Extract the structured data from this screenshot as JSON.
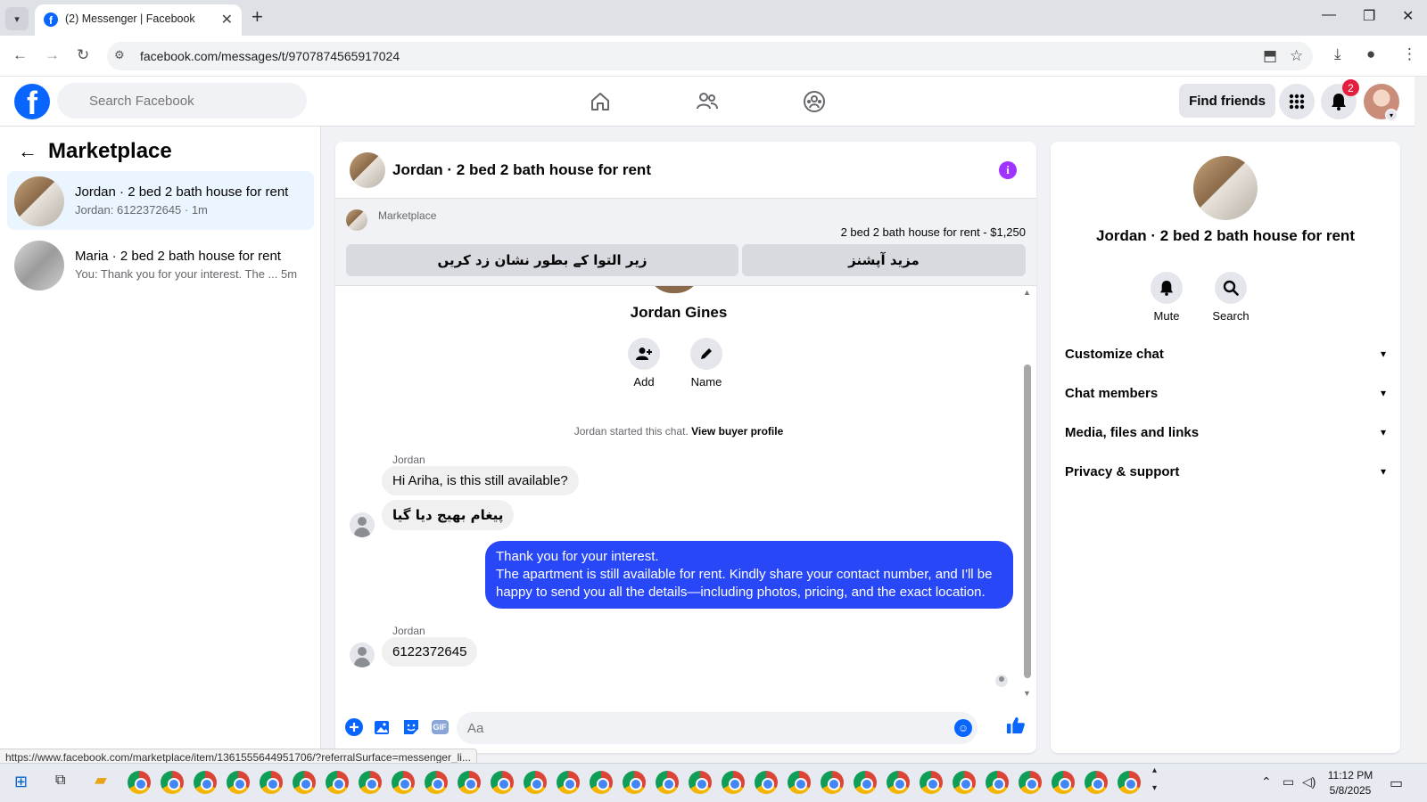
{
  "browser": {
    "tab_title": "(2) Messenger | Facebook",
    "url": "facebook.com/messages/t/9707874565917024",
    "status_url": "https://www.facebook.com/marketplace/item/1361555644951706/?referralSurface=messenger_li..."
  },
  "header": {
    "search_placeholder": "Search Facebook",
    "find_friends": "Find friends",
    "notification_count": "2"
  },
  "sidebar": {
    "title": "Marketplace",
    "conversations": [
      {
        "name": "Jordan · 2 bed 2 bath house for rent",
        "preview": "Jordan: 6122372645 · 1m"
      },
      {
        "name": "Maria · 2 bed 2 bath house for rent",
        "preview": "You: Thank you for your interest. The ...  5m"
      }
    ]
  },
  "chat": {
    "title": "Jordan · 2 bed 2 bath house for rent",
    "marketplace_label": "Marketplace",
    "listing": "2 bed 2 bath house for rent - $1,250",
    "btn_mark": "زیر التوا کے بطور نشان زد کریں",
    "btn_more": "مزید آپشنز",
    "person_name": "Jordan Gines",
    "actions": {
      "add": "Add",
      "name": "Name"
    },
    "started_text": "Jordan started this chat.",
    "view_profile": "View buyer profile",
    "messages": {
      "sender1": "Jordan",
      "msg1": "Hi Ariha, is this still available?",
      "msg2": "پیغام بھیج دیا گیا",
      "out_line1": "Thank you for your interest.",
      "out_line2": "The apartment is still available for rent. Kindly share your contact number, and I'll be happy to send you all the details—including photos, pricing, and the exact location.",
      "sender2": "Jordan",
      "msg3": "6122372645"
    },
    "composer_placeholder": "Aa",
    "gif_label": "GIF"
  },
  "info_panel": {
    "title": "Jordan · 2 bed 2 bath house for rent",
    "mute": "Mute",
    "search": "Search",
    "sections": [
      "Customize chat",
      "Chat members",
      "Media, files and links",
      "Privacy & support"
    ]
  },
  "taskbar": {
    "time": "11:12 PM",
    "date": "5/8/2025"
  },
  "colors": {
    "brand": "#0866ff",
    "outgoing_bubble": "#2847f6",
    "info_icon": "#a033ff",
    "badge": "#e41e3f"
  }
}
